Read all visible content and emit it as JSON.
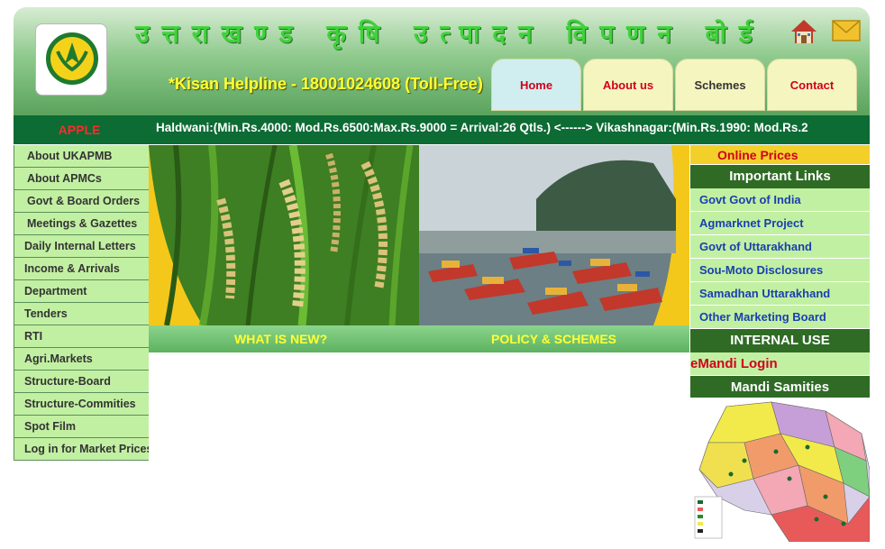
{
  "header": {
    "hindi_title": "उत्तराखण्ड कृषि उत्पादन विपणन बोर्ड",
    "helpline": "*Kisan Helpline - 18001024608 (Toll-Free)"
  },
  "tabs": [
    {
      "label": "Home"
    },
    {
      "label": "About us"
    },
    {
      "label": "Schemes"
    },
    {
      "label": "Contact"
    }
  ],
  "ticker": {
    "label": "APPLE",
    "text": "Haldwani:(Min.Rs.4000: Mod.Rs.6500:Max.Rs.9000 = Arrival:26 Qtls.) <------> Vikashnagar:(Min.Rs.1990: Mod.Rs.2"
  },
  "leftnav": {
    "items": [
      {
        "label": "About UKAPMB"
      },
      {
        "label": "About APMCs"
      },
      {
        "label": "Govt & Board Orders"
      },
      {
        "label": "Meetings & Gazettes"
      },
      {
        "label": "Daily Internal Letters"
      },
      {
        "label": "Income & Arrivals"
      },
      {
        "label": "Department"
      },
      {
        "label": "Tenders"
      },
      {
        "label": "RTI"
      },
      {
        "label": "Agri.Markets"
      },
      {
        "label": "Structure-Board"
      },
      {
        "label": "Structure-Commities"
      },
      {
        "label": "Spot Film"
      },
      {
        "label": "Log in for Market Prices"
      }
    ]
  },
  "center": {
    "whats_new": "WHAT IS NEW?",
    "policy": "POLICY & SCHEMES"
  },
  "right": {
    "online_prices": "Online Prices",
    "important_links_title": "Important Links",
    "links": [
      {
        "label": "Govt Govt of India"
      },
      {
        "label": "Agmarknet Project"
      },
      {
        "label": "Govt of Uttarakhand"
      },
      {
        "label": "Sou-Moto Disclosures"
      },
      {
        "label": "Samadhan Uttarakhand"
      },
      {
        "label": "Other Marketing Board"
      }
    ],
    "internal_use_title": "INTERNAL USE",
    "emandi": "eMandi Login",
    "mandi_samities_title": "Mandi Samities"
  },
  "colors": {
    "nav_bg": "#c2f0a2",
    "dark_green": "#0d6b34",
    "accent_red": "#d0001c",
    "link_blue": "#1a3fb0",
    "yellow_text": "#ffff33"
  },
  "icons": [
    "home-icon",
    "mail-icon",
    "logo-emblem"
  ]
}
